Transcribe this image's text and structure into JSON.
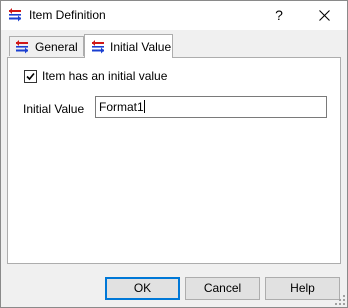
{
  "window": {
    "title": "Item Definition",
    "help_label": "?",
    "icon": "item-definition-icon",
    "close_icon": "close-icon"
  },
  "tabs": [
    {
      "label": "General",
      "icon": "item-definition-icon",
      "active": false
    },
    {
      "label": "Initial Value",
      "icon": "item-definition-icon",
      "active": true
    }
  ],
  "panel": {
    "has_initial_value": {
      "label": "Item has an initial value",
      "checked": true
    },
    "initial_value": {
      "label": "Initial Value",
      "value": "Format1"
    }
  },
  "buttons": {
    "ok": "OK",
    "cancel": "Cancel",
    "help": "Help"
  },
  "colors": {
    "icon_red": "#d01818",
    "icon_blue": "#1a3fd1",
    "focus_border": "#0078d7"
  }
}
